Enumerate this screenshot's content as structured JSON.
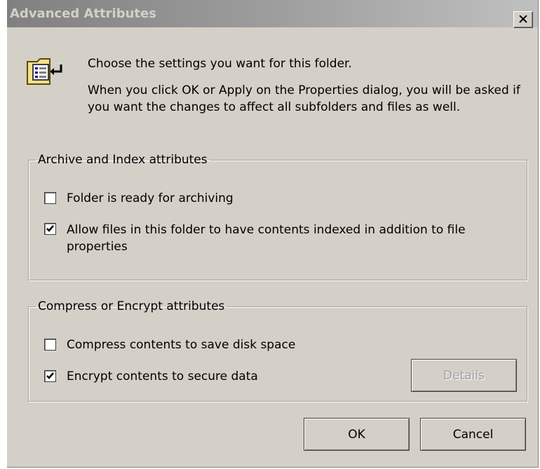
{
  "window": {
    "title": "Advanced Attributes",
    "close_icon": "close-icon"
  },
  "intro": {
    "icon": "folder-settings-icon",
    "line1": "Choose the settings you want for this folder.",
    "line2": "When you click OK or Apply on the Properties dialog, you will be asked if you want the changes to affect all subfolders and files as well."
  },
  "archive_group": {
    "legend": "Archive and Index attributes",
    "items": [
      {
        "label": "Folder is ready for archiving",
        "checked": false
      },
      {
        "label": "Allow files in this folder to have contents indexed in addition to file properties",
        "checked": true
      }
    ]
  },
  "compress_group": {
    "legend": "Compress or Encrypt attributes",
    "items": [
      {
        "label": "Compress contents to save disk space",
        "checked": false
      },
      {
        "label": "Encrypt contents to secure data",
        "checked": true
      }
    ],
    "details_label": "Details",
    "details_enabled": false
  },
  "buttons": {
    "ok": "OK",
    "cancel": "Cancel"
  },
  "colors": {
    "dialog_bg": "#d4d0c8",
    "title_inactive_start": "#808080",
    "title_inactive_end": "#c0c0c0"
  }
}
